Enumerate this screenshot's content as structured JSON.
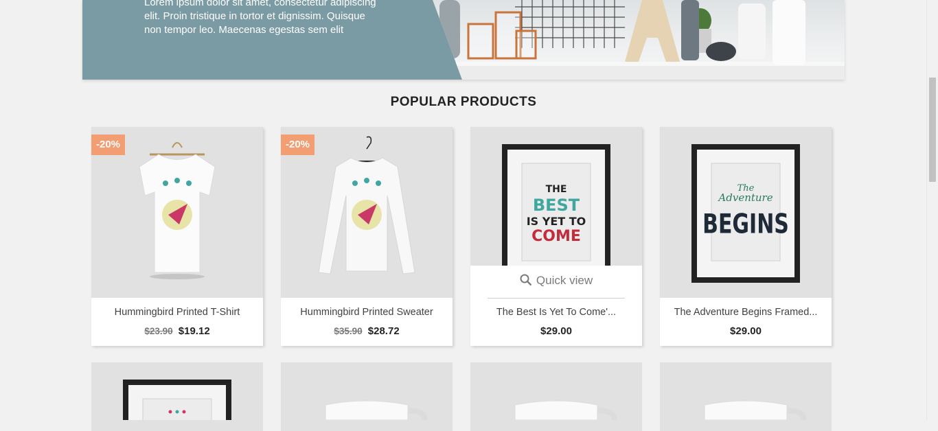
{
  "banner": {
    "text": "Lorem ipsum dolor sit amet, consectetur adipiscing elit. Proin tristique in tortor et dignissim. Quisque non tempor leo. Maecenas egestas sem elit"
  },
  "section": {
    "title": "POPULAR PRODUCTS"
  },
  "products": [
    {
      "name": "Hummingbird Printed T-Shirt",
      "badge": "-20%",
      "old_price": "$23.90",
      "price": "$19.12"
    },
    {
      "name": "Hummingbird Printed Sweater",
      "badge": "-20%",
      "old_price": "$35.90",
      "price": "$28.72"
    },
    {
      "name": "The Best Is Yet To Come'...",
      "price": "$29.00",
      "quick_view": "Quick view"
    },
    {
      "name": "The Adventure Begins Framed...",
      "price": "$29.00"
    }
  ],
  "icons": {
    "quick_view": "search-icon"
  },
  "colors": {
    "badge": "#f39d72",
    "banner": "#7a9aa4",
    "background": "#f1f1f1"
  }
}
